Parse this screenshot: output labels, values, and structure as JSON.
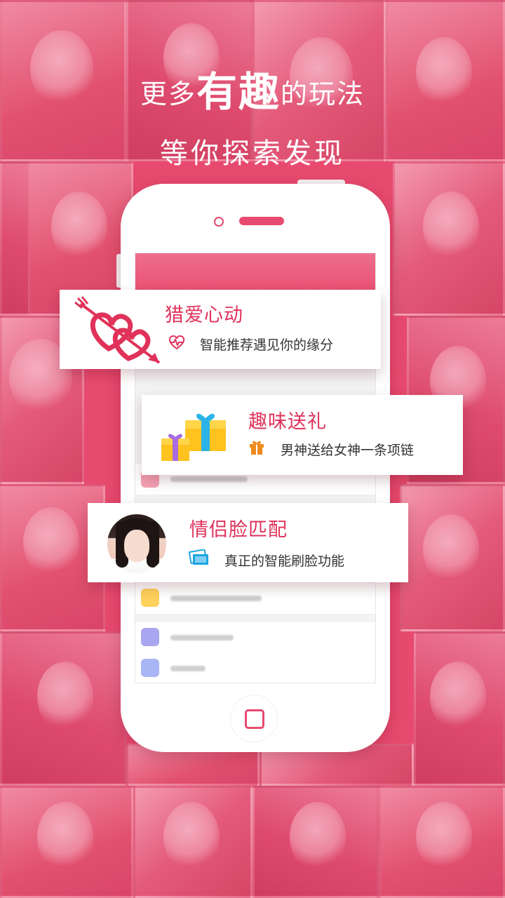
{
  "headline": {
    "prefix": "更多",
    "emphasis": "有趣",
    "suffix": "的玩法",
    "subline": "等你探索发现"
  },
  "features": [
    {
      "title": "猎爱心动",
      "description": "智能推荐遇见你的缘分",
      "icon": "hearts-arrow-icon",
      "small_icon": "heartbeat-icon"
    },
    {
      "title": "趣味送礼",
      "description": "男神送给女神一条项链",
      "icon": "gift-boxes-icon",
      "small_icon": "gift-icon"
    },
    {
      "title": "情侣脸匹配",
      "description": "真正的智能刷脸功能",
      "icon": "avatar-photo",
      "small_icon": "photo-cards-icon"
    }
  ],
  "colors": {
    "brand_pink": "#e84a6f",
    "title_red": "#e0325a",
    "gift_orange": "#f08a1c",
    "photo_blue": "#1fa6e0"
  }
}
